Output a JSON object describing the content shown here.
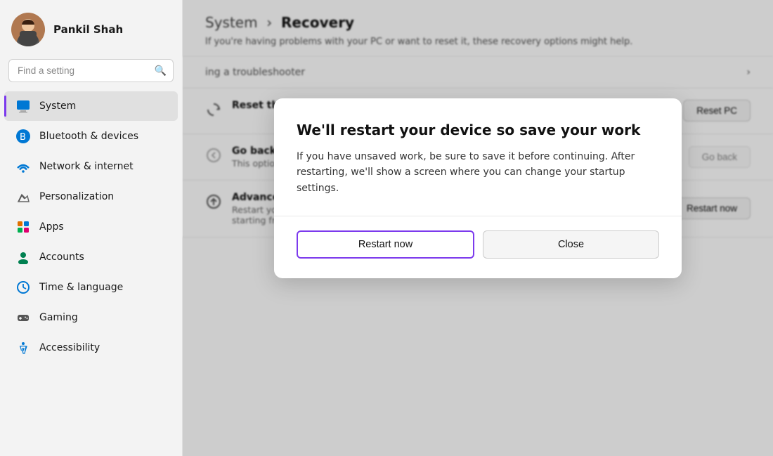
{
  "sidebar": {
    "user": {
      "name": "Pankil Shah"
    },
    "search": {
      "placeholder": "Find a setting"
    },
    "nav_items": [
      {
        "id": "system",
        "label": "System",
        "icon": "🖥",
        "active": true
      },
      {
        "id": "bluetooth",
        "label": "Bluetooth & devices",
        "icon": "🔵",
        "active": false
      },
      {
        "id": "network",
        "label": "Network & internet",
        "icon": "🌐",
        "active": false
      },
      {
        "id": "personalization",
        "label": "Personalization",
        "icon": "✏️",
        "active": false
      },
      {
        "id": "apps",
        "label": "Apps",
        "icon": "🟫",
        "active": false
      },
      {
        "id": "accounts",
        "label": "Accounts",
        "icon": "👤",
        "active": false
      },
      {
        "id": "time",
        "label": "Time & language",
        "icon": "🌍",
        "active": false
      },
      {
        "id": "gaming",
        "label": "Gaming",
        "icon": "🎮",
        "active": false
      },
      {
        "id": "accessibility",
        "label": "Accessibility",
        "icon": "♿",
        "active": false
      }
    ]
  },
  "header": {
    "breadcrumb_parent": "System",
    "breadcrumb_child": "Recovery",
    "subtitle": "If you're having problems with your PC or want to reset it, these recovery options might help."
  },
  "recovery_options": [
    {
      "id": "troubleshooter",
      "label": "ing a troubleshooter",
      "type": "link"
    },
    {
      "id": "reset",
      "title": "Reset this PC",
      "description": "",
      "action_label": "Reset PC"
    },
    {
      "id": "go_back",
      "title": "Go back",
      "description": "This option is no longer available on this PC",
      "action_label": "Go back",
      "disabled": true
    },
    {
      "id": "advanced_startup",
      "title": "Advanced startup",
      "description": "Restart your device to change startup settings, including starting from a disc or USB drive",
      "action_label": "Restart now"
    }
  ],
  "dialog": {
    "title": "We'll restart your device so save your work",
    "body": "If you have unsaved work, be sure to save it before continuing. After restarting, we'll show a screen where you can change your startup settings.",
    "btn_restart": "Restart now",
    "btn_close": "Close"
  }
}
